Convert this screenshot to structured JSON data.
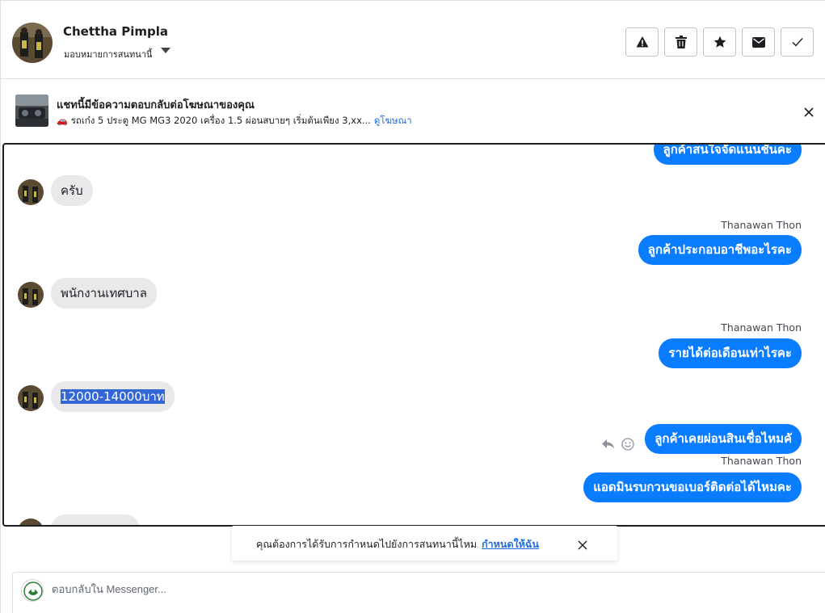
{
  "header": {
    "contact_name": "Chettha Pimpla",
    "assign_label": "มอบหมายการสนทนานี้",
    "actions": [
      {
        "name": "report-spam-button",
        "icon": "warning-icon"
      },
      {
        "name": "delete-button",
        "icon": "trash-icon"
      },
      {
        "name": "star-button",
        "icon": "star-icon"
      },
      {
        "name": "mark-unread-button",
        "icon": "envelope-icon"
      },
      {
        "name": "mark-done-button",
        "icon": "check-icon"
      }
    ]
  },
  "ad": {
    "title": "แชทนี้มีข้อความตอบกลับต่อโฆษณาของคุณ",
    "description": "รถเก๋ง 5 ประตู MG MG3 2020 เครื่อง 1.5 ผ่อนสบายๆ เริ่มต้นเพียง 3,xx...",
    "link_label": "ดูโฆษณา",
    "car_emoji": "🚗"
  },
  "messages": [
    {
      "side": "out",
      "text": "ลูกค้าสนใจจัดแนนชันคะ",
      "sender": ""
    },
    {
      "side": "in",
      "text": "ครับ"
    },
    {
      "side": "out",
      "text": "ลูกค้าประกอบอาชีพอะไรคะ",
      "sender": "Thanawan Thon"
    },
    {
      "side": "in",
      "text": "พนักงานเทศบาล"
    },
    {
      "side": "out",
      "text": "รายได้ต่อเดือนเท่าไรคะ",
      "sender": "Thanawan Thon"
    },
    {
      "side": "in",
      "text": "12000-14000บาท",
      "selected": true
    },
    {
      "side": "out",
      "text": "ลูกค้าเคยผ่อนสินเชื่อไหมคั",
      "sender": ""
    },
    {
      "side": "out",
      "text": "แอดมินรบกวนขอเบอร์ติดต่อได้ไหมคะ",
      "sender": "Thanawan Thon"
    }
  ],
  "reminder": {
    "text": "คุณต้องการได้รับการกำหนดไปยังการสนทนานี้ไหม",
    "link_label": "กำหนดให้ฉัน"
  },
  "composer": {
    "placeholder": "ตอบกลับใน Messenger..."
  },
  "colors": {
    "outgoing_bubble": "#0a7cff",
    "incoming_bubble": "#e9e9eb",
    "link": "#216fdb"
  }
}
